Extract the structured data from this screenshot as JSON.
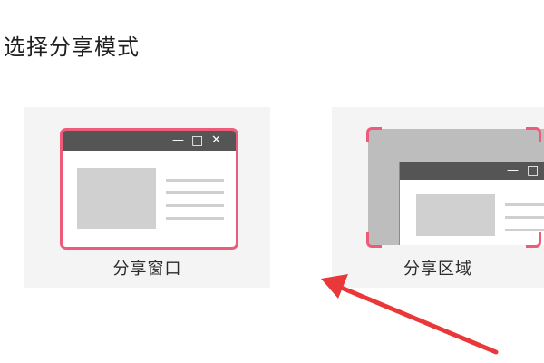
{
  "dialog": {
    "title": "选择分享模式"
  },
  "options": [
    {
      "label": "分享窗口",
      "icon": "share-window-icon"
    },
    {
      "label": "分享区域",
      "icon": "share-region-icon"
    }
  ],
  "window_controls": {
    "minimize": "—",
    "maximize": "□",
    "close": "✕"
  },
  "colors": {
    "accent": "#ee5a79",
    "titlebar": "#555555",
    "card_bg": "#f4f4f4",
    "arrow": "#e8383a"
  }
}
